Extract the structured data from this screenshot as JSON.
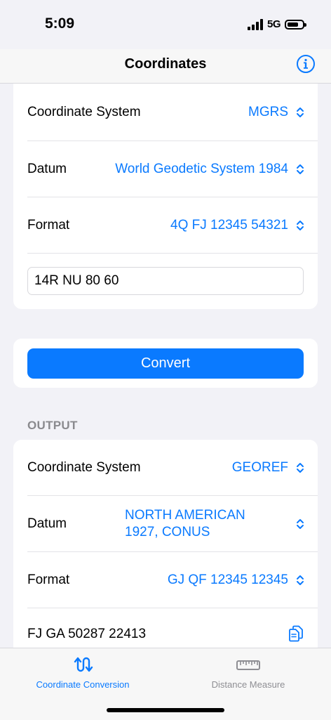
{
  "status_bar": {
    "time": "5:09",
    "network": "5G"
  },
  "nav": {
    "title": "Coordinates",
    "info_icon": "info-circle-icon"
  },
  "input": {
    "coordinate_system": {
      "label": "Coordinate System",
      "value": "MGRS"
    },
    "datum": {
      "label": "Datum",
      "value": "World Geodetic System 1984"
    },
    "format": {
      "label": "Format",
      "value": "4Q FJ 12345 54321"
    },
    "coordinate_value": "14R NU 80 60"
  },
  "convert_label": "Convert",
  "output": {
    "header": "OUTPUT",
    "coordinate_system": {
      "label": "Coordinate System",
      "value": "GEOREF"
    },
    "datum": {
      "label": "Datum",
      "value_line1": "NORTH AMERICAN",
      "value_line2": "1927, CONUS"
    },
    "format": {
      "label": "Format",
      "value": "GJ QF 12345 12345"
    },
    "result": "FJ GA 50287 22413",
    "copy_icon": "copy-icon"
  },
  "tabs": [
    {
      "label": "Coordinate Conversion",
      "icon": "conversion-arrows-icon",
      "active": true
    },
    {
      "label": "Distance Measure",
      "icon": "ruler-icon",
      "active": false
    }
  ],
  "colors": {
    "accent": "#0a7aff",
    "inactive": "#8e8e93"
  }
}
